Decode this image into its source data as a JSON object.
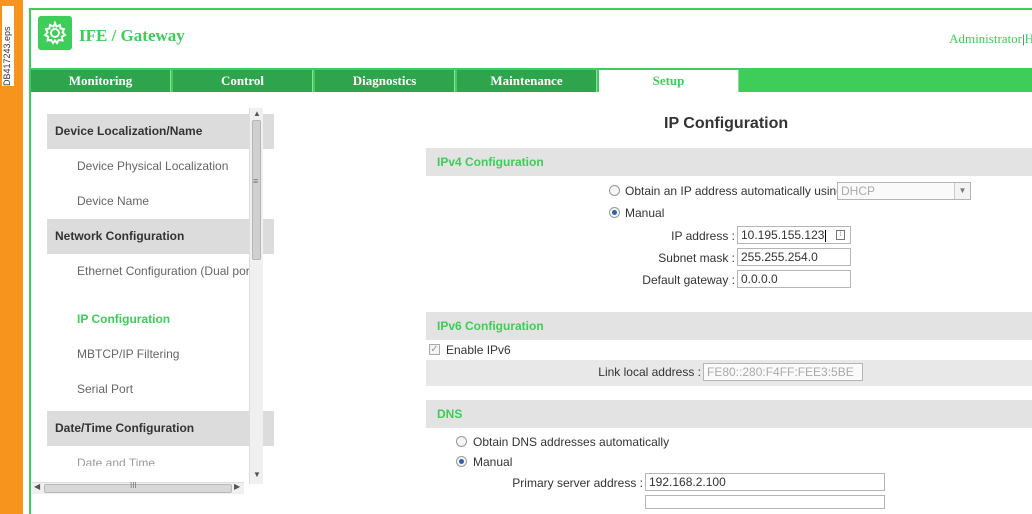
{
  "doc_id": "DB417243.eps",
  "header": {
    "app_title": "IFE / Gateway",
    "user_label": "Administrator",
    "separator": "|",
    "truncated_link": "H"
  },
  "nav": {
    "tabs": [
      {
        "label": "Monitoring"
      },
      {
        "label": "Control"
      },
      {
        "label": "Diagnostics"
      },
      {
        "label": "Maintenance"
      },
      {
        "label": "Setup",
        "active": true
      }
    ]
  },
  "sidebar": {
    "sections": [
      {
        "title": "Device Localization/Name",
        "items": [
          "Device Physical Localization",
          "Device Name"
        ]
      },
      {
        "title": "Network Configuration",
        "items": [
          "Ethernet Configuration (Dual port)",
          "IP Configuration",
          "MBTCP/IP Filtering",
          "Serial Port"
        ]
      },
      {
        "title": "Date/Time Configuration",
        "items": [
          "Date and Time"
        ]
      }
    ],
    "active_item": "IP Configuration",
    "scroll_grip": "≡",
    "hscroll_grip": "III"
  },
  "main": {
    "title": "IP Configuration",
    "ipv4": {
      "heading": "IPv4 Configuration",
      "auto_label": "Obtain an IP address automatically using",
      "auto_method": "DHCP",
      "manual_label": "Manual",
      "ip_label": "IP address :",
      "ip_value": "10.195.155.123",
      "subnet_label": "Subnet mask :",
      "subnet_value": "255.255.254.0",
      "gateway_label": "Default gateway :",
      "gateway_value": "0.0.0.0",
      "selected": "manual"
    },
    "ipv6": {
      "heading": "IPv6 Configuration",
      "enable_label": "Enable IPv6",
      "enabled": true,
      "link_local_label": "Link local address :",
      "link_local_value": "FE80::280:F4FF:FEE3:5BE"
    },
    "dns": {
      "heading": "DNS",
      "auto_label": "Obtain DNS addresses automatically",
      "manual_label": "Manual",
      "primary_label": "Primary server address :",
      "primary_value": "192.168.2.100",
      "selected": "manual"
    }
  },
  "colors": {
    "brand_green": "#3dcd58",
    "accent_orange": "#f7941d",
    "section_gray": "#e3e3e3"
  }
}
